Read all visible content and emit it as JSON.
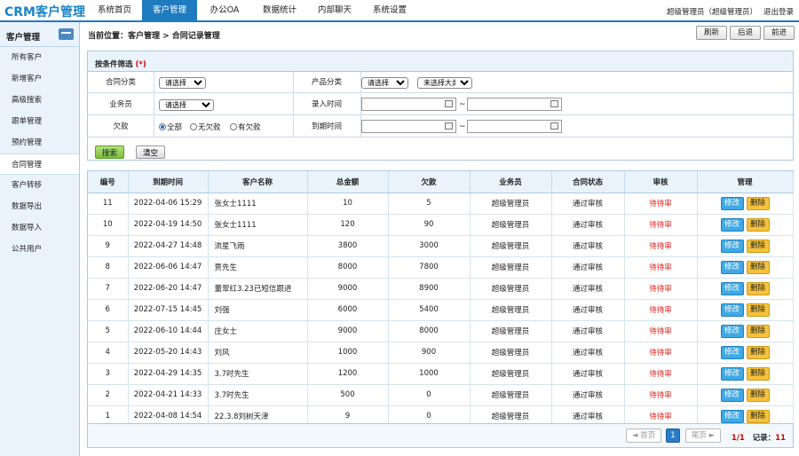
{
  "app": {
    "logo": "CRM客户管理"
  },
  "nav": {
    "items": [
      "系统首页",
      "客户管理",
      "办公OA",
      "数据统计",
      "内部聊天",
      "系统设置"
    ],
    "active": 1
  },
  "user": {
    "name": "超级管理员（超级管理员）",
    "logout": "退出登录"
  },
  "sidebar": {
    "title": "客户管理",
    "icon": "card-icon",
    "items": [
      "所有客户",
      "新增客户",
      "高级搜索",
      "跟单管理",
      "预约管理",
      "合同管理",
      "客户转移",
      "数据导出",
      "数据导入",
      "公共用户"
    ],
    "active": 5
  },
  "breadcrumb": "当前位置：客户管理 > 合同记录管理",
  "toolbar": {
    "refresh": "刷新",
    "back": "后退",
    "forward": "前进"
  },
  "filter": {
    "title": "按条件筛选",
    "required_mark": "(*)",
    "contract_type_label": "合同分类",
    "contract_type_value": "请选择",
    "product_type_label": "产品分类",
    "product_type_value": "请选择",
    "product_big_value": "未选择大类",
    "salesman_label": "业务员",
    "salesman_value": "请选择",
    "entry_time_label": "录入时间",
    "debt_label": "欠款",
    "debt_options": [
      "全部",
      "无欠款",
      "有欠款"
    ],
    "expire_time_label": "到期时间",
    "range_sep": "~",
    "search_btn": "搜索",
    "clear_btn": "清空"
  },
  "table": {
    "headers": [
      "编号",
      "到期时间",
      "客户名称",
      "总金额",
      "欠款",
      "业务员",
      "合同状态",
      "审核",
      "管理"
    ],
    "edit_label": "修改",
    "delete_label": "删除",
    "rows": [
      {
        "id": "11",
        "expire": "2022-04-06 15:29",
        "customer": "张女士1111",
        "total": "10",
        "debt": "5",
        "salesman": "超级管理员",
        "status": "通过审核",
        "audit": "待待审"
      },
      {
        "id": "10",
        "expire": "2022-04-19 14:50",
        "customer": "张女士1111",
        "total": "120",
        "debt": "90",
        "salesman": "超级管理员",
        "status": "通过审核",
        "audit": "待待审"
      },
      {
        "id": "9",
        "expire": "2022-04-27 14:48",
        "customer": "流星飞雨",
        "total": "3800",
        "debt": "3000",
        "salesman": "超级管理员",
        "status": "通过审核",
        "audit": "待待审"
      },
      {
        "id": "8",
        "expire": "2022-06-06 14:47",
        "customer": "贾先生",
        "total": "8000",
        "debt": "7800",
        "salesman": "超级管理员",
        "status": "通过审核",
        "audit": "待待审"
      },
      {
        "id": "7",
        "expire": "2022-06-20 14:47",
        "customer": "董翠红3.23已短信跟进",
        "total": "9000",
        "debt": "8900",
        "salesman": "超级管理员",
        "status": "通过审核",
        "audit": "待待审"
      },
      {
        "id": "6",
        "expire": "2022-07-15 14:45",
        "customer": "刘强",
        "total": "6000",
        "debt": "5400",
        "salesman": "超级管理员",
        "status": "通过审核",
        "audit": "待待审"
      },
      {
        "id": "5",
        "expire": "2022-06-10 14:44",
        "customer": "庄女士",
        "total": "9000",
        "debt": "8000",
        "salesman": "超级管理员",
        "status": "通过审核",
        "audit": "待待审"
      },
      {
        "id": "4",
        "expire": "2022-05-20 14:43",
        "customer": "刘风",
        "total": "1000",
        "debt": "900",
        "salesman": "超级管理员",
        "status": "通过审核",
        "audit": "待待审"
      },
      {
        "id": "3",
        "expire": "2022-04-29 14:35",
        "customer": "3.7时先生",
        "total": "1200",
        "debt": "1000",
        "salesman": "超级管理员",
        "status": "通过审核",
        "audit": "待待审"
      },
      {
        "id": "2",
        "expire": "2022-04-21 14:33",
        "customer": "3.7时先生",
        "total": "500",
        "debt": "0",
        "salesman": "超级管理员",
        "status": "通过审核",
        "audit": "待待审"
      },
      {
        "id": "1",
        "expire": "2022-04-08 14:54",
        "customer": "22.3.8刘树天津",
        "total": "9",
        "debt": "0",
        "salesman": "超级管理员",
        "status": "通过审核",
        "audit": "待待审"
      }
    ]
  },
  "pager": {
    "first": "◄ 首页",
    "current": "1",
    "last": "尾页 ►",
    "page_info": "1/1",
    "record_label": "记录：",
    "record_count": "11"
  }
}
